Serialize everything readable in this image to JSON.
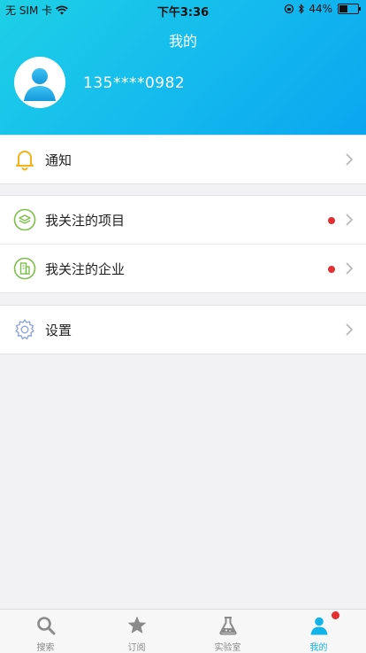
{
  "status_bar": {
    "carrier": "无 SIM 卡",
    "time": "下午3:36",
    "battery_text": "44%",
    "battery_level": 0.44
  },
  "header": {
    "title": "我的",
    "phone": "135****0982"
  },
  "menu": {
    "notify": {
      "label": "通知"
    },
    "followed_projects": {
      "label": "我关注的项目",
      "has_dot": true
    },
    "followed_companies": {
      "label": "我关注的企业",
      "has_dot": true
    },
    "settings": {
      "label": "设置"
    }
  },
  "tabbar": {
    "search": {
      "label": "搜索",
      "icon": "search-icon"
    },
    "subscribe": {
      "label": "订阅",
      "icon": "star-icon"
    },
    "lab": {
      "label": "实验室",
      "icon": "flask-icon"
    },
    "mine": {
      "label": "我的",
      "icon": "user-icon",
      "active": true,
      "has_dot": true
    }
  },
  "colors": {
    "accent": "#12b3e8",
    "badge": "#e32f2f",
    "bell": "#f1b21a",
    "green_icon": "#7cbf4a",
    "gear": "#8fa3d9"
  }
}
